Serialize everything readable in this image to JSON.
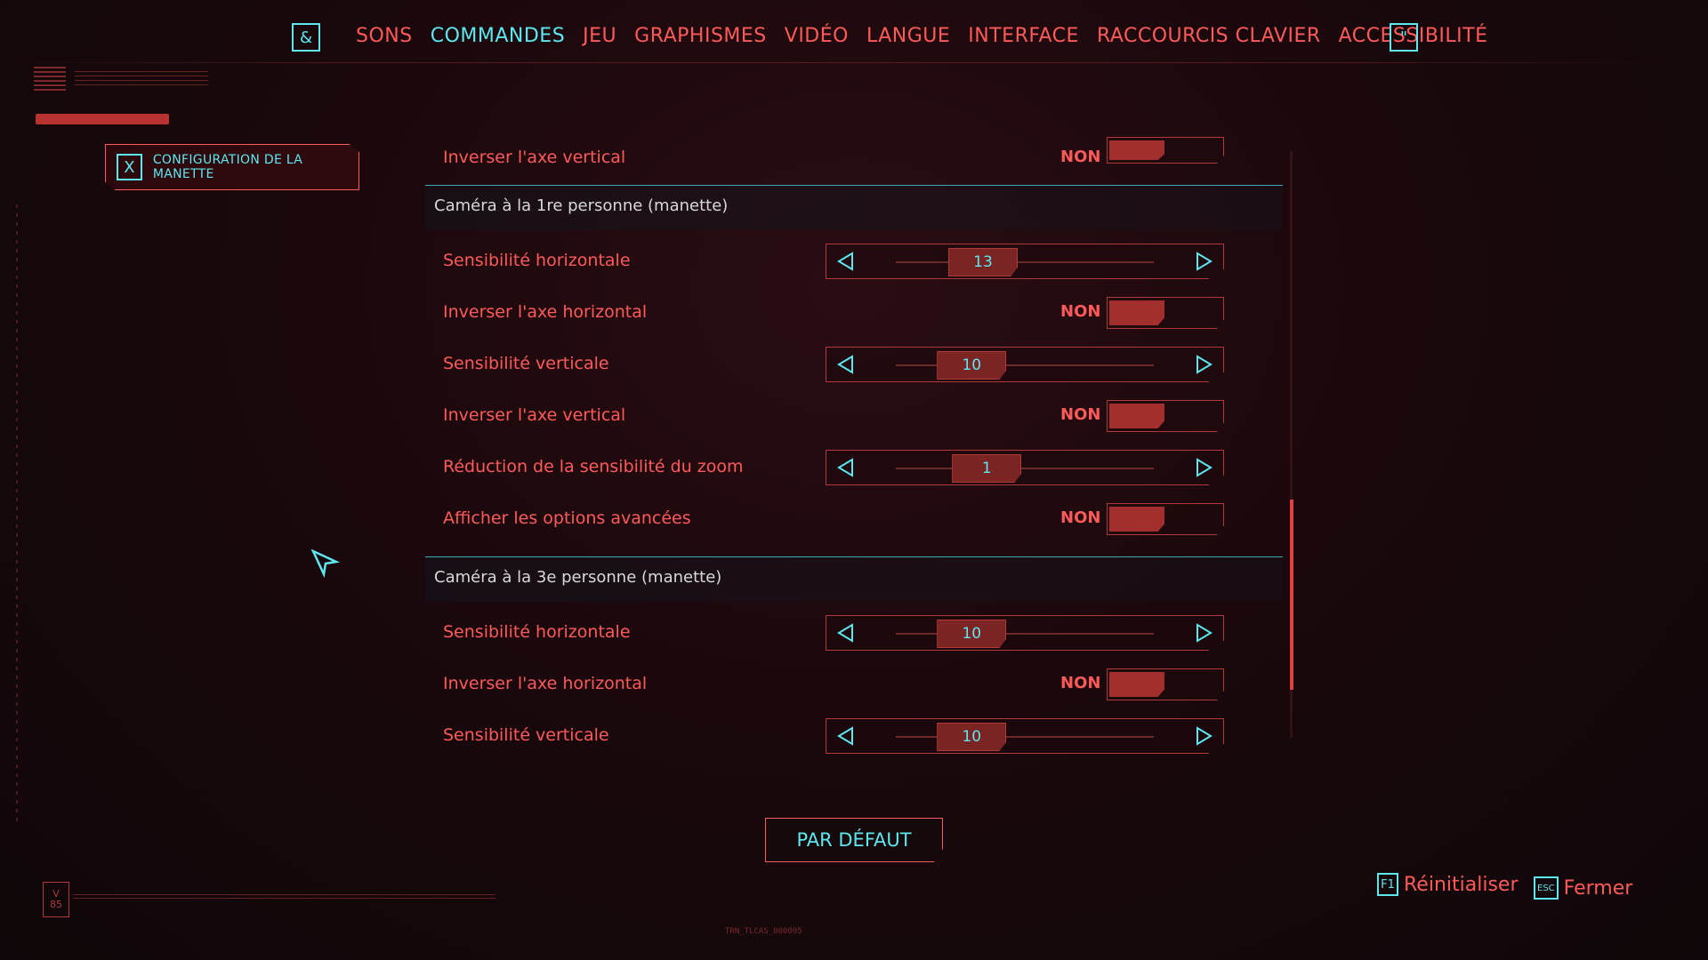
{
  "topbar": {
    "left_key": "&",
    "right_key": "\"",
    "tabs": [
      {
        "label": "SONS"
      },
      {
        "label": "COMMANDES"
      },
      {
        "label": "JEU"
      },
      {
        "label": "GRAPHISMES"
      },
      {
        "label": "VIDÉO"
      },
      {
        "label": "LANGUE"
      },
      {
        "label": "INTERFACE"
      },
      {
        "label": "RACCOURCIS CLAVIER"
      },
      {
        "label": "ACCESSIBILITÉ"
      }
    ],
    "active_tab": "COMMANDES"
  },
  "sidebar": {
    "config_key": "X",
    "config_label": "CONFIGURATION DE LA MANETTE"
  },
  "settings": {
    "top_row": {
      "label": "Inverser l'axe vertical",
      "value": "NON"
    },
    "section1": {
      "title": "Caméra à la 1re personne (manette)",
      "rows": [
        {
          "label": "Sensibilité horizontale",
          "value": "13",
          "position": 0.25
        },
        {
          "label": "Inverser l'axe horizontal",
          "value": "NON"
        },
        {
          "label": "Sensibilité verticale",
          "value": "10",
          "position": 0.19
        },
        {
          "label": "Inverser l'axe vertical",
          "value": "NON"
        },
        {
          "label": "Réduction de la sensibilité du zoom",
          "value": "1",
          "position": 0.27
        },
        {
          "label": "Afficher les options avancées",
          "value": "NON"
        }
      ]
    },
    "section2": {
      "title": "Caméra à la 3e personne (manette)",
      "rows": [
        {
          "label": "Sensibilité horizontale",
          "value": "10",
          "position": 0.19
        },
        {
          "label": "Inverser l'axe horizontal",
          "value": "NON"
        },
        {
          "label": "Sensibilité verticale",
          "value": "10",
          "position": 0.19
        }
      ]
    }
  },
  "footer": {
    "default_button": "PAR DÉFAUT",
    "reset_key": "F1",
    "reset_label": "Réinitialiser",
    "close_key": "ESC",
    "close_label": "Fermer",
    "badge_top": "V",
    "badge_bottom": "85",
    "code": "TRN_TLCAS_800095"
  },
  "colors": {
    "accent_red": "#ff5a5a",
    "accent_cyan": "#5fe7f0",
    "background": "#1a080c"
  }
}
